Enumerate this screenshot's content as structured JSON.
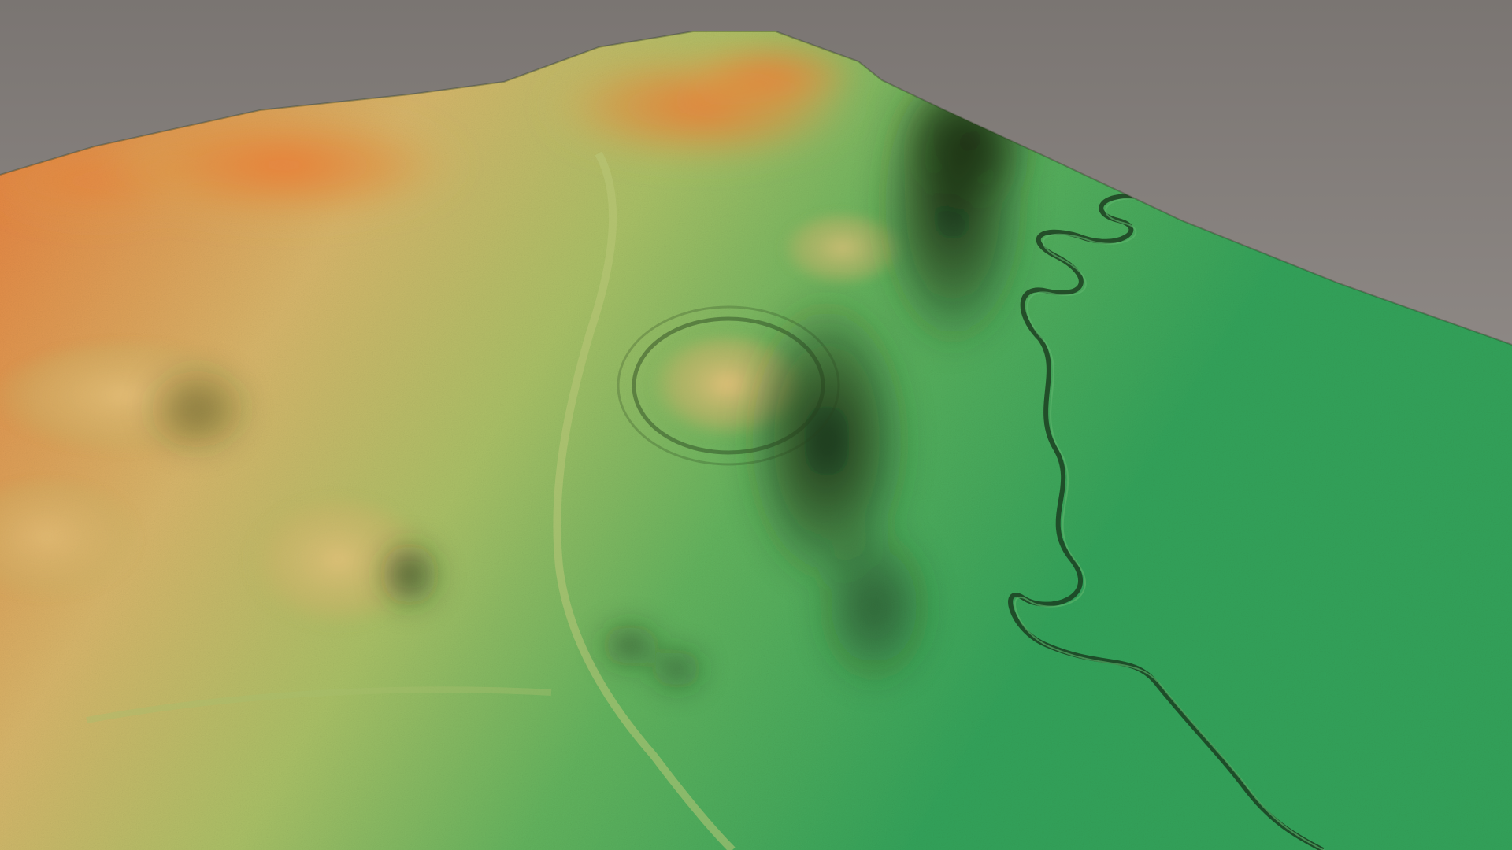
{
  "scene": {
    "subject": "",
    "colors": {
      "background_top": "#7a7572",
      "background_bottom": "#a8a29e",
      "terrain_low": "#33a25a",
      "terrain_mid_low": "#62b25d",
      "terrain_mid": "#a9bf66",
      "terrain_high": "#d6b56a",
      "terrain_peak": "#e5823f",
      "shadow": "#152612"
    }
  }
}
